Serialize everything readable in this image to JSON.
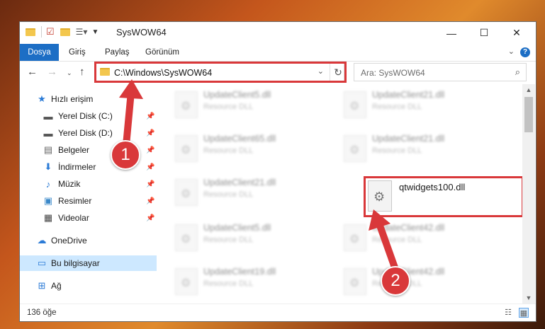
{
  "window": {
    "title": "SysWOW64"
  },
  "ribbon": {
    "tabs": [
      "Dosya",
      "Giriş",
      "Paylaş",
      "Görünüm"
    ]
  },
  "nav": {
    "address": "C:\\Windows\\SysWOW64",
    "search_placeholder": "Ara: SysWOW64"
  },
  "sidebar": {
    "items": [
      {
        "label": "Hızlı erişim",
        "icon": "star-icon"
      },
      {
        "label": "Yerel Disk (C:)",
        "icon": "drive-icon"
      },
      {
        "label": "Yerel Disk (D:)",
        "icon": "drive-icon"
      },
      {
        "label": "Belgeler",
        "icon": "document-icon"
      },
      {
        "label": "İndirmeler",
        "icon": "download-icon"
      },
      {
        "label": "Müzik",
        "icon": "music-icon"
      },
      {
        "label": "Resimler",
        "icon": "pictures-icon"
      },
      {
        "label": "Videolar",
        "icon": "video-icon"
      },
      {
        "label": "OneDrive",
        "icon": "cloud-icon"
      },
      {
        "label": "Bu bilgisayar",
        "icon": "computer-icon"
      },
      {
        "label": "Ağ",
        "icon": "network-icon"
      }
    ]
  },
  "files": [
    {
      "name": "UpdateClient5.dll",
      "desc": "Resource DLL"
    },
    {
      "name": "UpdateClient21.dll",
      "desc": "Resource DLL"
    },
    {
      "name": "UpdateClient65.dll",
      "desc": "Resource DLL"
    },
    {
      "name": "UpdateClient21.dll",
      "desc": "Resource DLL"
    },
    {
      "name": "UpdateClient21.dll",
      "desc": "Resource DLL"
    },
    {
      "name": "qtwidgets100.dll",
      "desc": ""
    },
    {
      "name": "UpdateClient5.dll",
      "desc": "Resource DLL"
    },
    {
      "name": "UpdateClient42.dll",
      "desc": "Resource DLL"
    },
    {
      "name": "UpdateClient19.dll",
      "desc": "Resource DLL"
    },
    {
      "name": "UpdateClient42.dll",
      "desc": "Resource DLL"
    }
  ],
  "status": {
    "count": "136 öğe"
  },
  "annotations": {
    "badge1": "1",
    "badge2": "2"
  },
  "colors": {
    "accent": "#1c6ec5",
    "highlight": "#d9383a"
  }
}
